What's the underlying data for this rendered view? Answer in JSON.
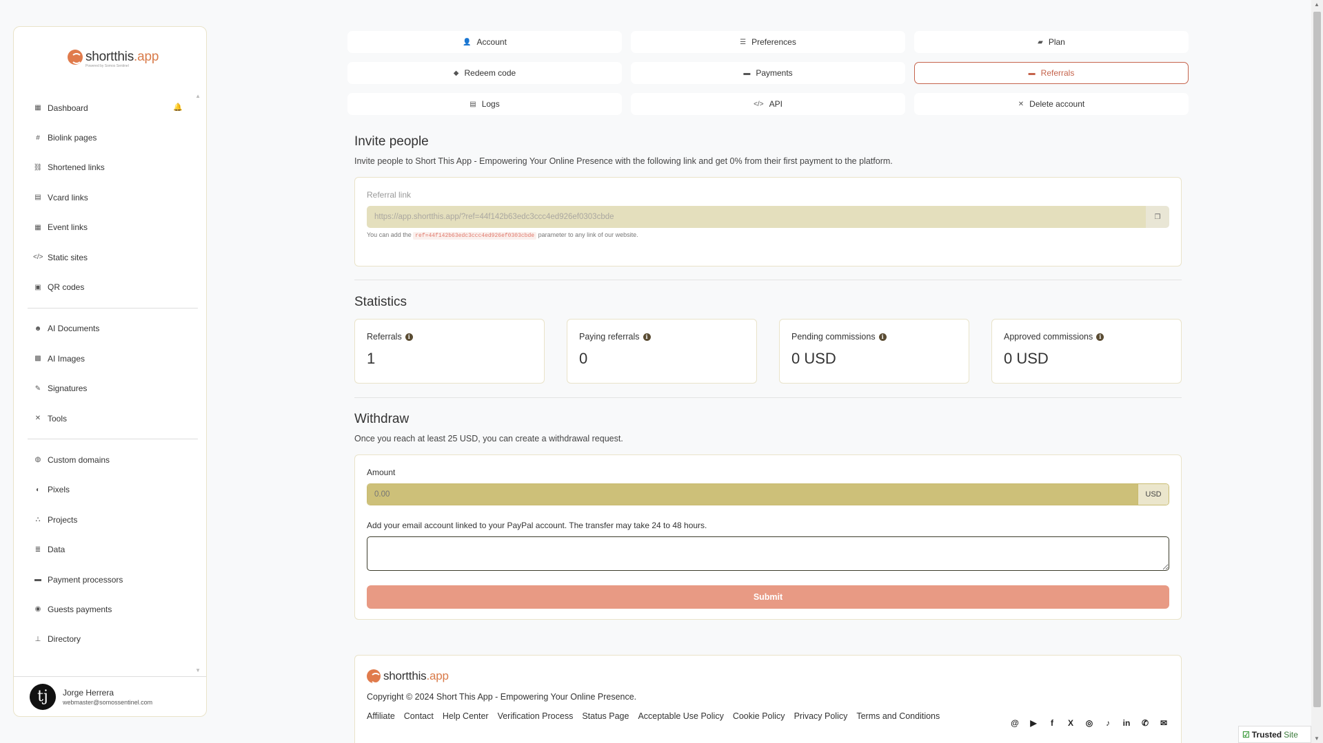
{
  "brand": {
    "logo_main": "shortthis",
    "logo_accent": ".app",
    "logo_tagline": "Powered by Somos Sentinel"
  },
  "sidebar": {
    "groups": [
      [
        {
          "label": "Dashboard",
          "icon": "dashboard-icon",
          "glyph": "▦"
        },
        {
          "label": "Biolink pages",
          "icon": "hashtag-icon",
          "glyph": "#"
        },
        {
          "label": "Shortened links",
          "icon": "link-icon",
          "glyph": "⛓"
        },
        {
          "label": "Vcard links",
          "icon": "vcard-icon",
          "glyph": "▤"
        },
        {
          "label": "Event links",
          "icon": "calendar-icon",
          "glyph": "▦"
        },
        {
          "label": "Static sites",
          "icon": "code-icon",
          "glyph": "</>"
        },
        {
          "label": "QR codes",
          "icon": "qrcode-icon",
          "glyph": "▣"
        }
      ],
      [
        {
          "label": "AI Documents",
          "icon": "robot-icon",
          "glyph": "☻"
        },
        {
          "label": "AI Images",
          "icon": "images-icon",
          "glyph": "▩"
        },
        {
          "label": "Signatures",
          "icon": "signature-icon",
          "glyph": "✎"
        },
        {
          "label": "Tools",
          "icon": "tools-icon",
          "glyph": "✕"
        }
      ],
      [
        {
          "label": "Custom domains",
          "icon": "globe-icon",
          "glyph": "◍"
        },
        {
          "label": "Pixels",
          "icon": "adjust-icon",
          "glyph": "◐"
        },
        {
          "label": "Projects",
          "icon": "project-diagram-icon",
          "glyph": "⛬"
        },
        {
          "label": "Data",
          "icon": "database-icon",
          "glyph": "≣"
        },
        {
          "label": "Payment processors",
          "icon": "credit-card-icon",
          "glyph": "▬"
        },
        {
          "label": "Guests payments",
          "icon": "coins-icon",
          "glyph": "◉"
        },
        {
          "label": "Directory",
          "icon": "sitemap-icon",
          "glyph": "⊥"
        }
      ]
    ],
    "user": {
      "name": "Jorge Herrera",
      "email": "webmaster@somossentinel.com",
      "avatar_glyph": "tj"
    }
  },
  "tabs": [
    {
      "label": "Account",
      "icon": "user-cog-icon",
      "glyph": "👤",
      "active": false
    },
    {
      "label": "Preferences",
      "icon": "sliders-icon",
      "glyph": "☰",
      "active": false
    },
    {
      "label": "Plan",
      "icon": "box-open-icon",
      "glyph": "▰",
      "active": false
    },
    {
      "label": "Redeem code",
      "icon": "tags-icon",
      "glyph": "◆",
      "active": false
    },
    {
      "label": "Payments",
      "icon": "credit-card-icon",
      "glyph": "▬",
      "active": false
    },
    {
      "label": "Referrals",
      "icon": "wallet-icon",
      "glyph": "▬",
      "active": true
    },
    {
      "label": "Logs",
      "icon": "scroll-icon",
      "glyph": "▤",
      "active": false
    },
    {
      "label": "API",
      "icon": "code-icon",
      "glyph": "</>",
      "active": false
    },
    {
      "label": "Delete account",
      "icon": "times-icon",
      "glyph": "✕",
      "active": false
    }
  ],
  "invite": {
    "title": "Invite people",
    "description": "Invite people to Short This App - Empowering Your Online Presence with the following link and get 0% from their first payment to the platform.",
    "link_label": "Referral link",
    "link_value": "https://app.shortthis.app/?ref=44f142b63edc3ccc4ed926ef0303cbde",
    "hint_before": "You can add the",
    "hint_code": "ref=44f142b63edc3ccc4ed926ef0303cbde",
    "hint_after": "parameter to any link of our website."
  },
  "statistics": {
    "title": "Statistics",
    "cards": [
      {
        "label": "Referrals",
        "value": "1"
      },
      {
        "label": "Paying referrals",
        "value": "0"
      },
      {
        "label": "Pending commissions",
        "value": "0 USD"
      },
      {
        "label": "Approved commissions",
        "value": "0 USD"
      }
    ]
  },
  "withdraw": {
    "title": "Withdraw",
    "description": "Once you reach at least 25 USD, you can create a withdrawal request.",
    "amount_label": "Amount",
    "amount_placeholder": "0.00",
    "currency": "USD",
    "paypal_label": "Add your email account linked to your PayPal account. The transfer may take 24 to 48 hours.",
    "submit_label": "Submit"
  },
  "footer": {
    "copyright": "Copyright © 2024 Short This App - Empowering Your Online Presence.",
    "links": [
      "Affiliate",
      "Contact",
      "Help Center",
      "Verification Process",
      "Status Page",
      "Acceptable Use Policy",
      "Cookie Policy",
      "Privacy Policy",
      "Terms and Conditions"
    ],
    "social": [
      {
        "icon": "threads-icon",
        "glyph": "@"
      },
      {
        "icon": "youtube-icon",
        "glyph": "▶"
      },
      {
        "icon": "facebook-icon",
        "glyph": "f"
      },
      {
        "icon": "x-twitter-icon",
        "glyph": "X"
      },
      {
        "icon": "instagram-icon",
        "glyph": "◎"
      },
      {
        "icon": "tiktok-icon",
        "glyph": "♪"
      },
      {
        "icon": "linkedin-icon",
        "glyph": "in"
      },
      {
        "icon": "whatsapp-icon",
        "glyph": "✆"
      },
      {
        "icon": "envelope-icon",
        "glyph": "✉"
      }
    ]
  },
  "trusted_badge": {
    "main": "Trusted",
    "suffix": "Site"
  },
  "colors": {
    "accent": "#c5634b",
    "input_olive": "#cdc079",
    "submit": "#e89a84",
    "card_border": "#e9e3c9"
  }
}
